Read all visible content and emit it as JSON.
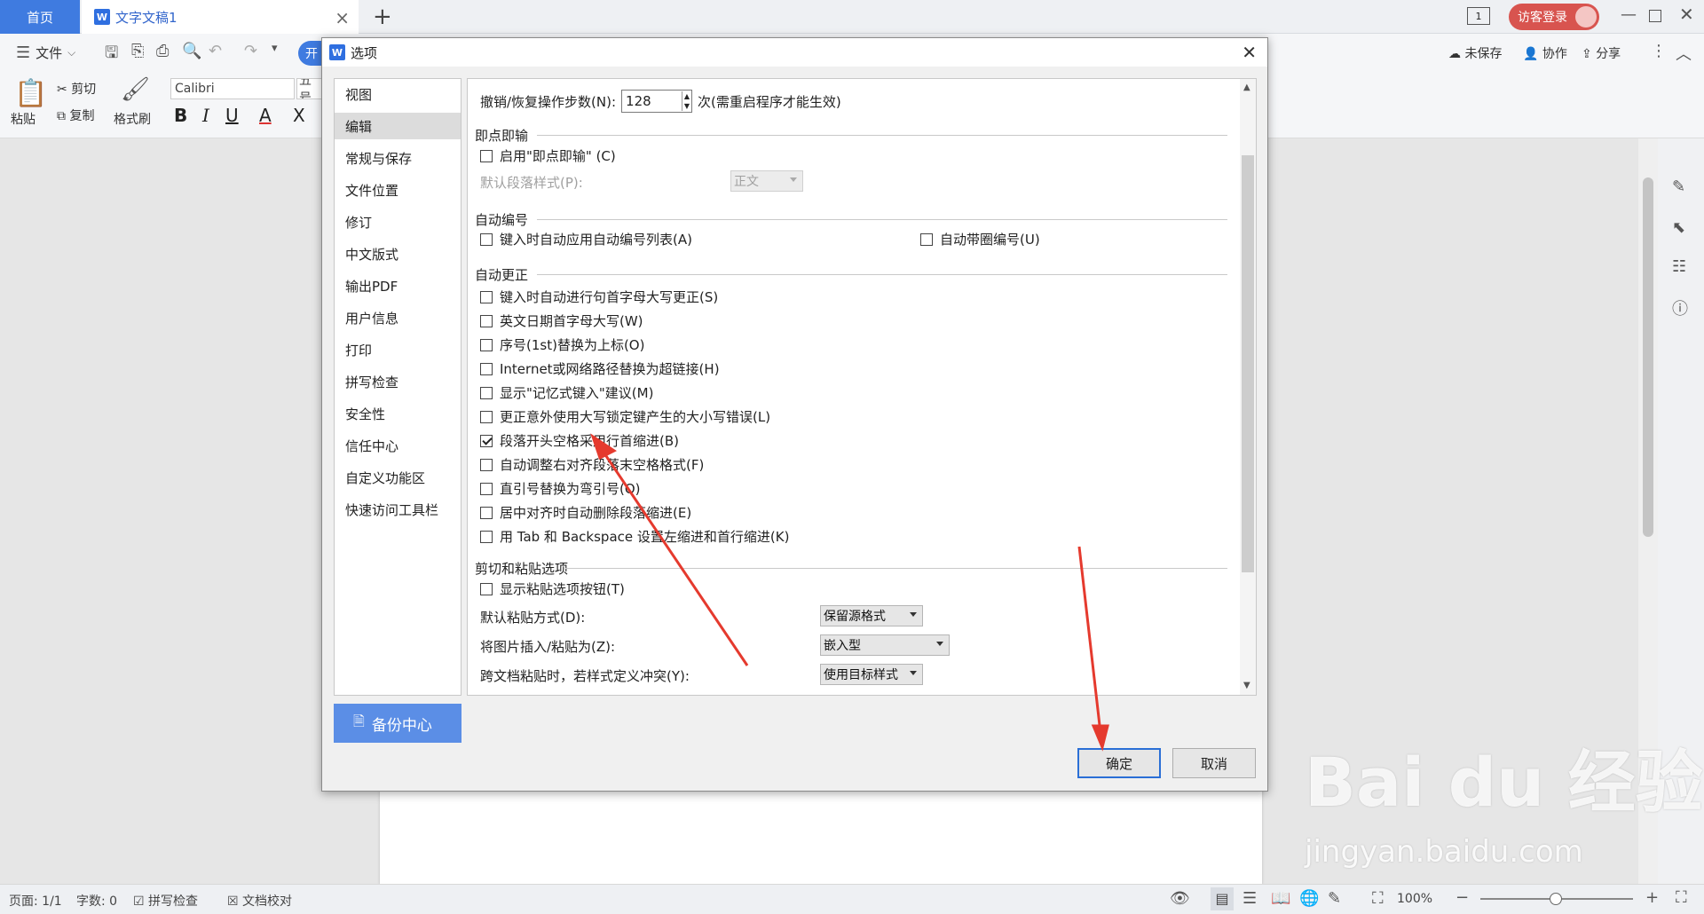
{
  "tabs": {
    "home": "首页",
    "doc": "文字文稿1",
    "add": "+",
    "close": "×"
  },
  "titlebar": {
    "login": "访客登录",
    "page_indicator": "1"
  },
  "menu": {
    "file": "文件",
    "start": "开",
    "unsaved": "未保存",
    "collab": "协作",
    "share": "分享"
  },
  "ribbon": {
    "paste": "粘贴",
    "cut": "剪切",
    "copy": "复制",
    "format_painter": "格式刷",
    "font": "Calibri",
    "size": "五号",
    "bold": "B",
    "italic": "I",
    "underline": "U",
    "fontcolor": "A",
    "clear": "X"
  },
  "dialog": {
    "title": "选项",
    "nav": [
      "视图",
      "编辑",
      "常规与保存",
      "文件位置",
      "修订",
      "中文版式",
      "输出PDF",
      "用户信息",
      "打印",
      "拼写检查",
      "安全性",
      "信任中心",
      "自定义功能区",
      "快速访问工具栏"
    ],
    "selected_nav": "编辑",
    "backup": "备份中心",
    "undo_label": "撤销/恢复操作步数(N):",
    "undo_value": "128",
    "undo_note": "次(需重启程序才能生效)",
    "sec_click_type": "即点即输",
    "enable_click_type": "启用\"即点即输\" (C)",
    "default_para_label": "默认段落样式(P):",
    "default_para_value": "正文",
    "sec_autonum": "自动编号",
    "autonum_list": "键入时自动应用自动编号列表(A)",
    "autonum_circle": "自动带圈编号(U)",
    "sec_autocorrect": "自动更正",
    "autocorrect": [
      {
        "label": "键入时自动进行句首字母大写更正(S)",
        "checked": false
      },
      {
        "label": "英文日期首字母大写(W)",
        "checked": false
      },
      {
        "label": "序号(1st)替换为上标(O)",
        "checked": false
      },
      {
        "label": "Internet或网络路径替换为超链接(H)",
        "checked": false
      },
      {
        "label": "显示\"记忆式键入\"建议(M)",
        "checked": false
      },
      {
        "label": "更正意外使用大写锁定键产生的大小写错误(L)",
        "checked": false
      },
      {
        "label": "段落开头空格采用行首缩进(B)",
        "checked": true
      },
      {
        "label": "自动调整右对齐段落末空格格式(F)",
        "checked": false
      },
      {
        "label": "直引号替换为弯引号(Q)",
        "checked": false
      },
      {
        "label": "居中对齐时自动删除段落缩进(E)",
        "checked": false
      },
      {
        "label": "用 Tab 和 Backspace 设置左缩进和首行缩进(K)",
        "checked": false
      }
    ],
    "sec_paste": "剪切和粘贴选项",
    "show_paste_btn": "显示粘贴选项按钮(T)",
    "default_paste_label": "默认粘贴方式(D):",
    "default_paste_value": "保留源格式",
    "insert_pic_label": "将图片插入/粘贴为(Z):",
    "insert_pic_value": "嵌入型",
    "cross_doc_label": "跨文档粘贴时，若样式定义冲突(Y):",
    "cross_doc_value": "使用目标样式",
    "ok": "确定",
    "cancel": "取消"
  },
  "status": {
    "page": "页面: 1/1",
    "words": "字数: 0",
    "spell": "拼写检查",
    "proof": "文档校对",
    "zoom": "100%"
  },
  "watermark": {
    "brand": "Bai du 经验",
    "url": "jingyan.baidu.com"
  },
  "colors": {
    "accent": "#3f7be0",
    "login": "#d8544f",
    "arrow": "#e53a2e"
  }
}
